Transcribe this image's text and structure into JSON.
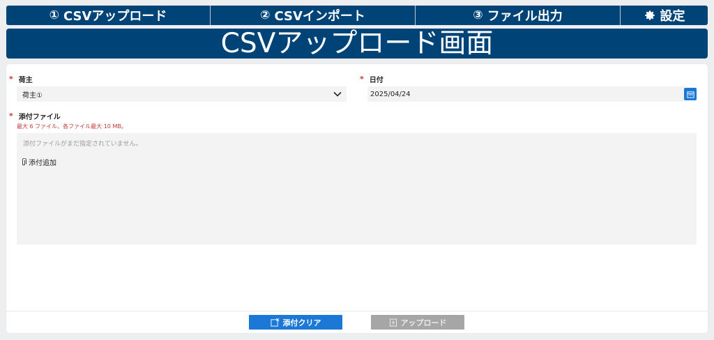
{
  "nav": {
    "tabs": [
      {
        "num": "①",
        "label": "CSVアップロード"
      },
      {
        "num": "②",
        "label": "CSVインポート"
      },
      {
        "num": "③",
        "label": "ファイル出力"
      },
      {
        "icon": "gear-icon",
        "label": "設定"
      }
    ]
  },
  "page": {
    "title": "CSVアップロード画面"
  },
  "form": {
    "required_mark": "*",
    "shipper": {
      "label": "荷主",
      "value": "荷主①",
      "icon": "chevron-down-icon"
    },
    "date": {
      "label": "日付",
      "value": "2025/04/24",
      "icon": "calendar-icon"
    },
    "attachments": {
      "label": "添付ファイル",
      "hint": "最大 6 ファイル、各ファイル最大 10 MB。",
      "empty_text": "添付ファイルがまだ指定されていません。",
      "add_label": "添付追加",
      "add_icon": "paperclip-icon"
    }
  },
  "actions": {
    "clear_label": "添付クリア",
    "upload_label": "アップロード"
  },
  "colors": {
    "brand": "#004477",
    "primary_button": "#1b78d6",
    "disabled_button": "#a6a6a6",
    "required": "#c23934"
  }
}
